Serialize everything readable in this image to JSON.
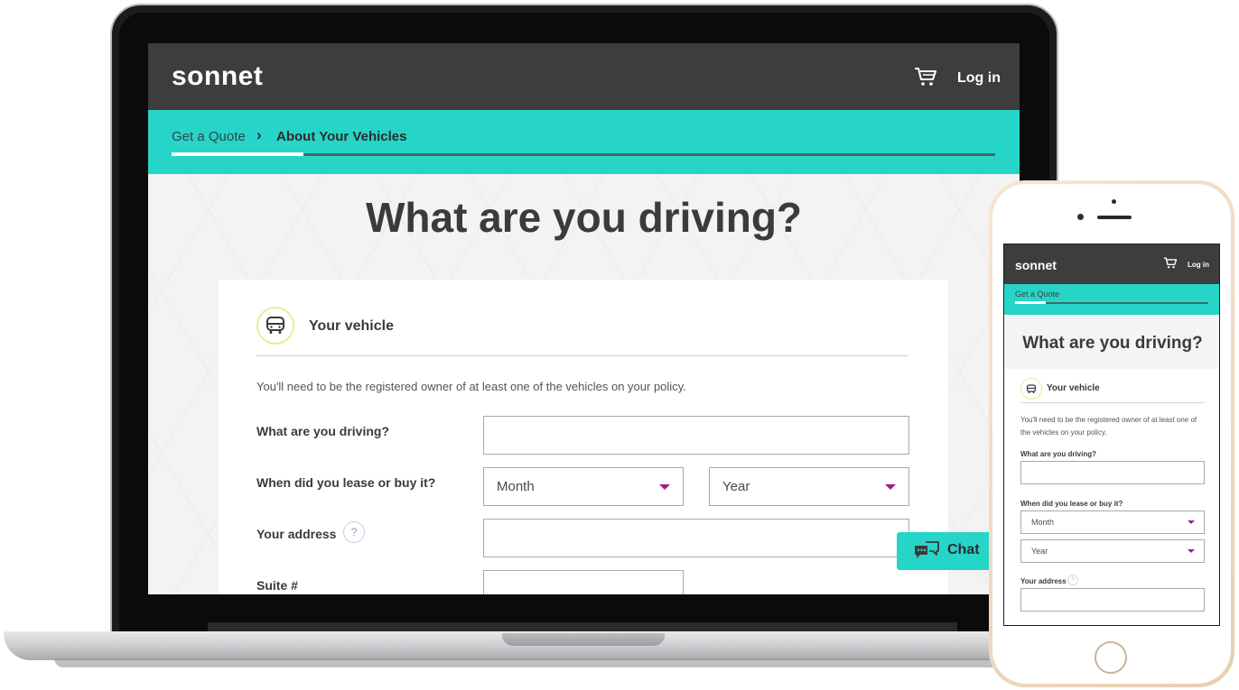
{
  "desktop": {
    "brand": "sonnet",
    "login": "Log in",
    "breadcrumb": {
      "first": "Get a Quote",
      "separator": "›",
      "current": "About Your Vehicles"
    },
    "progress_fraction": 0.16,
    "page_title": "What are you driving?",
    "section": {
      "title": "Your vehicle",
      "intro": "You'll need to be the registered owner of at least one of the vehicles on your policy."
    },
    "form": {
      "driving_label": "What are you driving?",
      "driving_value": "",
      "lease_label": "When did you lease or buy it?",
      "month_value": "Month",
      "year_value": "Year",
      "address_label": "Your address",
      "address_help": "?",
      "address_value": "",
      "suite_label": "Suite #",
      "suite_value": ""
    },
    "chat": {
      "label": "Chat"
    }
  },
  "mobile": {
    "brand": "sonnet",
    "login": "Log in",
    "breadcrumb_first": "Get a Quote",
    "progress_fraction": 0.16,
    "page_title": "What are you driving?",
    "section_title": "Your vehicle",
    "intro": "You'll need to be the registered owner of at least one of the vehicles on your policy.",
    "driving_label": "What are you driving?",
    "lease_label": "When did you lease or buy it?",
    "month_value": "Month",
    "year_value": "Year",
    "address_label": "Your address",
    "address_help": "?"
  },
  "colors": {
    "header_bg": "#3d3d3d",
    "accent_teal": "#27d5c8",
    "caret_purple": "#9b1e8e",
    "icon_ring": "#e5ef97"
  },
  "icons": {
    "cart": "cart-icon",
    "vehicle": "car-front-icon",
    "chevron": "chevron-right-icon",
    "dropdown": "chevron-down-icon",
    "help": "question-icon",
    "chat": "chat-bubbles-icon"
  }
}
